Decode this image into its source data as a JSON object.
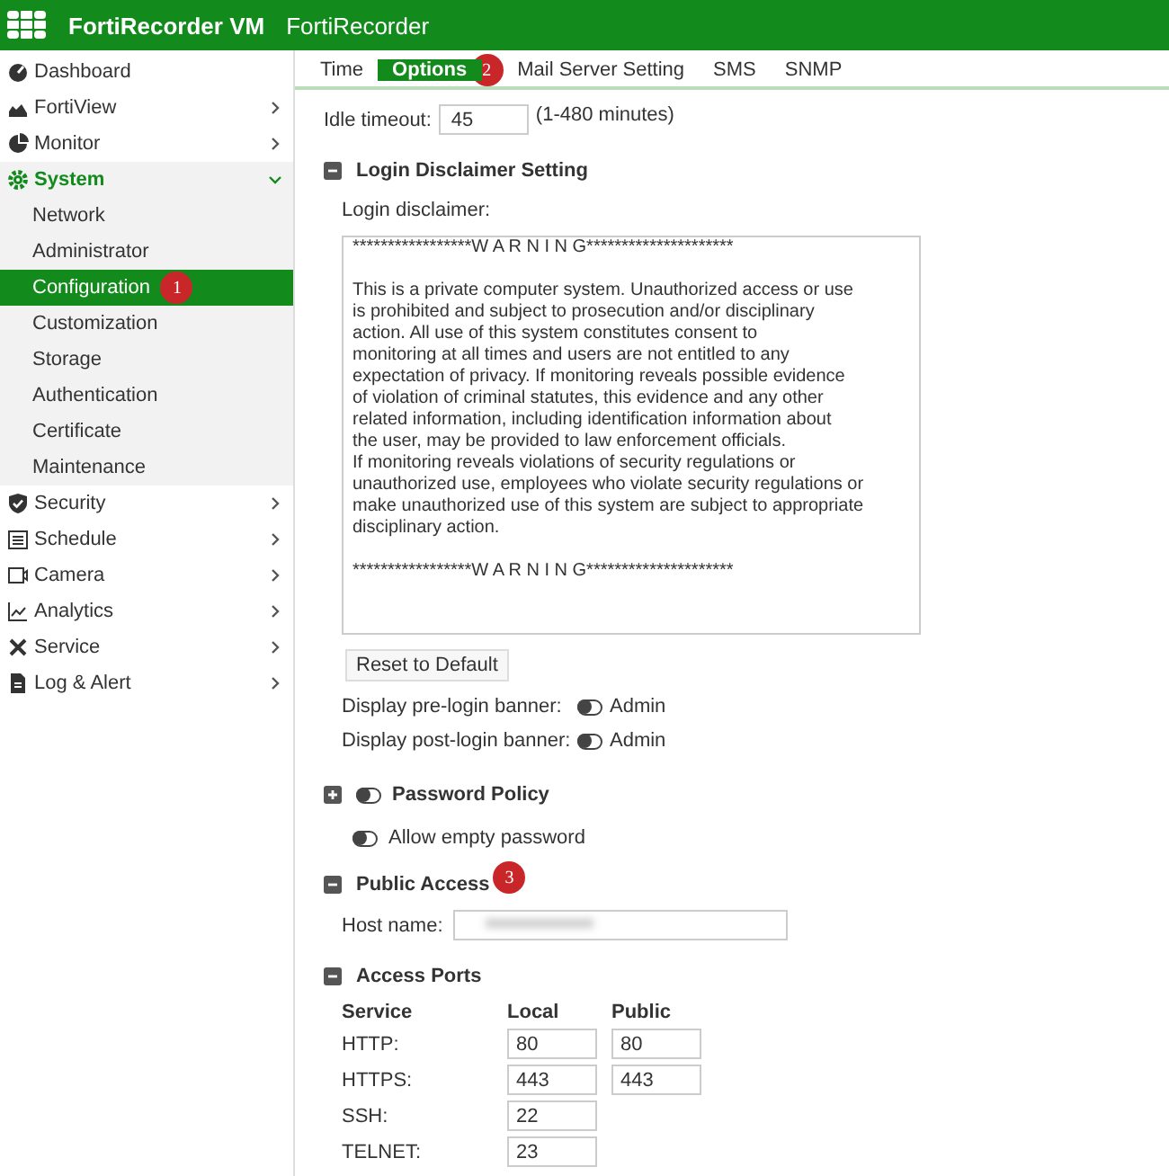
{
  "header": {
    "product": "FortiRecorder VM",
    "hostname": "FortiRecorder"
  },
  "sidebar": {
    "items": [
      {
        "label": "Dashboard",
        "has_arrow": false,
        "selected": false,
        "expanded": false
      },
      {
        "label": "FortiView",
        "has_arrow": true,
        "selected": false,
        "expanded": false
      },
      {
        "label": "Monitor",
        "has_arrow": true,
        "selected": false,
        "expanded": false
      },
      {
        "label": "System",
        "has_arrow": true,
        "selected": false,
        "expanded": true,
        "children": [
          {
            "label": "Network",
            "selected": false
          },
          {
            "label": "Administrator",
            "selected": false
          },
          {
            "label": "Configuration",
            "selected": true,
            "badge": "1"
          },
          {
            "label": "Customization",
            "selected": false
          },
          {
            "label": "Storage",
            "selected": false
          },
          {
            "label": "Authentication",
            "selected": false
          },
          {
            "label": "Certificate",
            "selected": false
          },
          {
            "label": "Maintenance",
            "selected": false
          }
        ]
      },
      {
        "label": "Security",
        "has_arrow": true,
        "selected": false,
        "expanded": false
      },
      {
        "label": "Schedule",
        "has_arrow": true,
        "selected": false,
        "expanded": false
      },
      {
        "label": "Camera",
        "has_arrow": true,
        "selected": false,
        "expanded": false
      },
      {
        "label": "Analytics",
        "has_arrow": true,
        "selected": false,
        "expanded": false
      },
      {
        "label": "Service",
        "has_arrow": true,
        "selected": false,
        "expanded": false
      },
      {
        "label": "Log & Alert",
        "has_arrow": true,
        "selected": false,
        "expanded": false
      }
    ]
  },
  "tabs": [
    {
      "label": "Time",
      "selected": false
    },
    {
      "label": "Options",
      "selected": true,
      "badge": "2"
    },
    {
      "label": "Mail Server Setting",
      "selected": false
    },
    {
      "label": "SMS",
      "selected": false
    },
    {
      "label": "SNMP",
      "selected": false
    }
  ],
  "idle_timeout": {
    "label": "Idle timeout:",
    "value": "45",
    "hint": "(1-480 minutes)"
  },
  "login_disclaimer": {
    "title": "Login Disclaimer Setting",
    "expanded": true,
    "label": "Login disclaimer:",
    "paragraphs": [
      [
        "*****************W A R N I N G*********************"
      ],
      [
        "This is a private computer system. Unauthorized access or use",
        "is prohibited and subject to prosecution and/or disciplinary",
        "action. All use of this system constitutes consent to",
        "monitoring at all times and users are not entitled to any",
        "expectation of privacy. If monitoring reveals possible evidence",
        "of violation of criminal statutes, this evidence and any other",
        "related information, including identification information about",
        "the user, may be provided to law enforcement officials.",
        "If monitoring reveals violations of security regulations or",
        "unauthorized use, employees who violate security regulations or",
        "make unauthorized use of this system are subject to appropriate",
        "disciplinary action."
      ],
      [
        "*****************W A R N I N G*********************"
      ]
    ],
    "reset_button": "Reset to Default",
    "banners": [
      {
        "label": "Display pre-login banner:",
        "on": false,
        "toggle_label": "Admin"
      },
      {
        "label": "Display post-login banner:",
        "on": false,
        "toggle_label": "Admin"
      }
    ]
  },
  "password_policy": {
    "title": "Password Policy",
    "expanded": false,
    "on": false,
    "allow_empty": {
      "label": "Allow empty password",
      "on": false
    }
  },
  "public_access": {
    "title": "Public Access",
    "expanded": true,
    "badge": "3",
    "host_label": "Host name:"
  },
  "access_ports": {
    "title": "Access Ports",
    "expanded": true,
    "columns": [
      "Service",
      "Local",
      "Public"
    ],
    "rows": [
      {
        "service": "HTTP:",
        "local": "80",
        "public": "80"
      },
      {
        "service": "HTTPS:",
        "local": "443",
        "public": "443"
      },
      {
        "service": "SSH:",
        "local": "22"
      },
      {
        "service": "TELNET:",
        "local": "23"
      }
    ]
  }
}
